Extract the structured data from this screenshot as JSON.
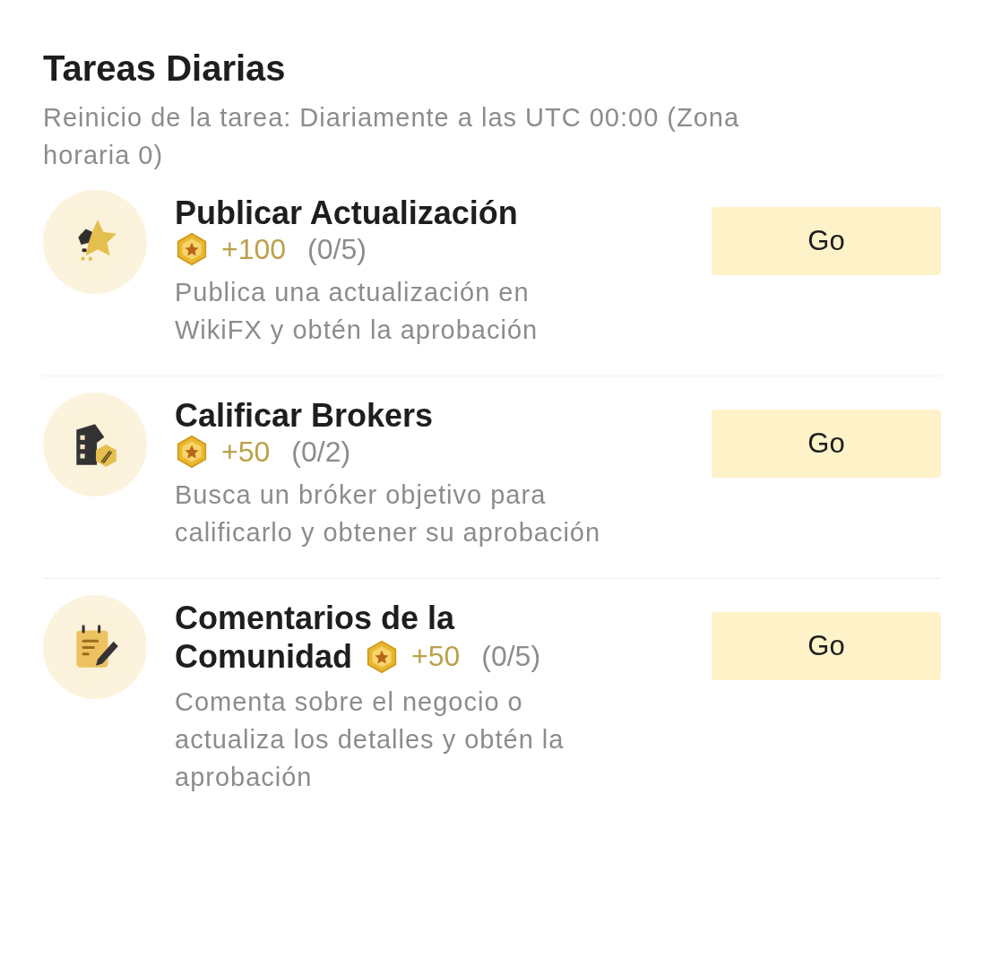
{
  "header": {
    "title": "Tareas Diarias",
    "subtitle": "Reinicio de la tarea: Diariamente a las UTC 00:00 (Zona horaria 0)"
  },
  "tasks": [
    {
      "kind": "stacked",
      "title": "Publicar Actualización",
      "points": "+100",
      "progress": "(0/5)",
      "description": "Publica una actualización en WikiFX y obtén la aprobación",
      "button": "Go"
    },
    {
      "kind": "stacked",
      "title": "Calificar Brokers",
      "points": "+50",
      "progress": "(0/2)",
      "description": "Busca un bróker objetivo para calificarlo y obtener su aprobación",
      "button": "Go"
    },
    {
      "kind": "inline",
      "title_lines": [
        "Comentarios de la",
        "Comunidad"
      ],
      "points": "+50",
      "progress": "(0/5)",
      "description": "Comenta sobre el negocio o actualiza los detalles y obtén la aprobación",
      "button": "Go"
    }
  ]
}
